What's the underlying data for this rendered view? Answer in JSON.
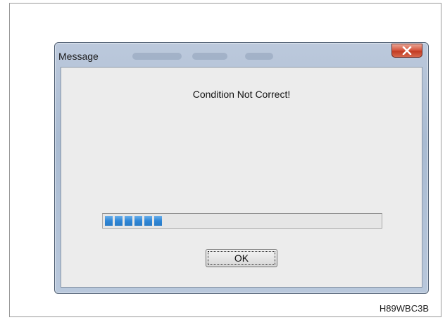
{
  "dialog": {
    "title": "Message",
    "message": "Condition Not Correct!",
    "ok_label": "OK",
    "progress_percent": 24,
    "progress_blocks": 6
  },
  "figure_code": "H89WBC3B",
  "icons": {
    "close": "close-icon"
  },
  "colors": {
    "progress_fill": "#2f86d6",
    "close_button": "#c23b22",
    "window_frame": "#a9bbd2",
    "client_bg": "#ececec"
  }
}
